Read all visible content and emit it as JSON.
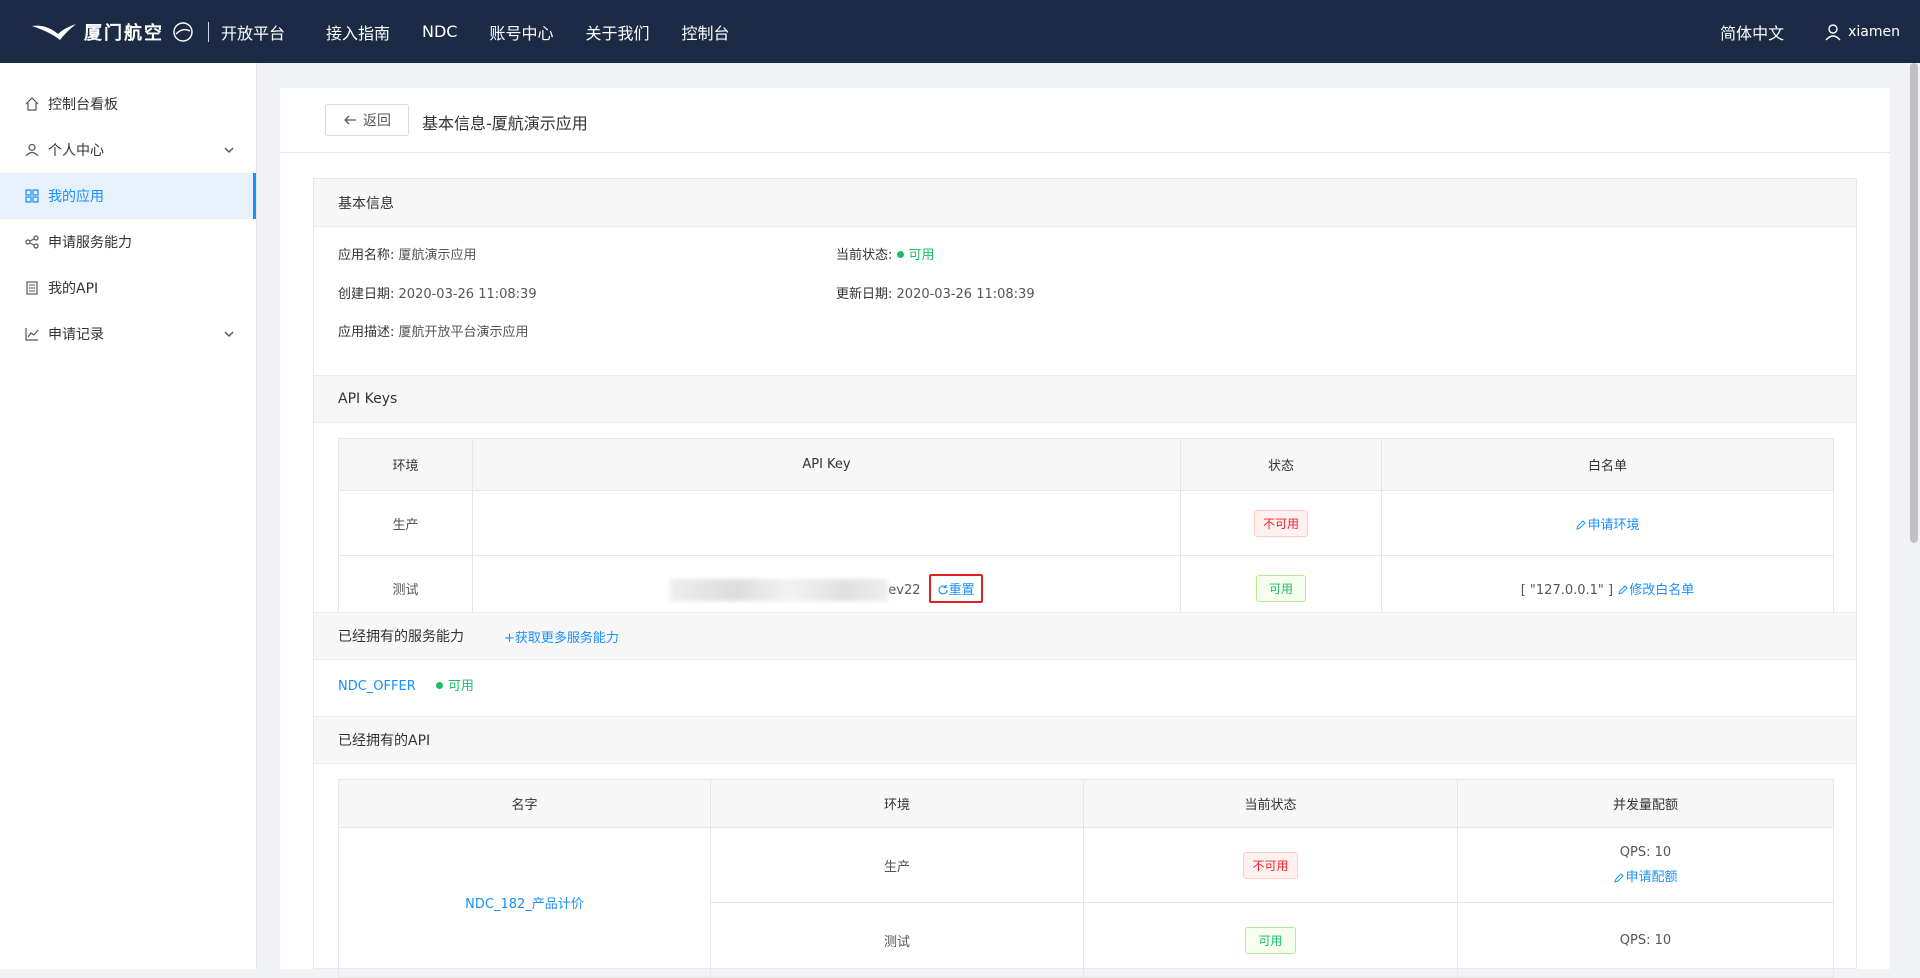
{
  "header": {
    "logo_text": "厦门航空",
    "platform": "开放平台",
    "nav": [
      "接入指南",
      "NDC",
      "账号中心",
      "关于我们",
      "控制台"
    ],
    "language": "简体中文",
    "username": "xiamen"
  },
  "sidebar": {
    "items": [
      {
        "label": "控制台看板",
        "icon": "home-icon"
      },
      {
        "label": "个人中心",
        "icon": "user-icon"
      },
      {
        "label": "我的应用",
        "icon": "grid-icon"
      },
      {
        "label": "申请服务能力",
        "icon": "share-icon"
      },
      {
        "label": "我的API",
        "icon": "doc-icon"
      },
      {
        "label": "申请记录",
        "icon": "chart-icon"
      }
    ]
  },
  "page": {
    "back_label": "返回",
    "title": "基本信息-厦航演示应用"
  },
  "basic_info": {
    "heading": "基本信息",
    "app_name_label": "应用名称:",
    "app_name": "厦航演示应用",
    "status_label": "当前状态:",
    "status": "可用",
    "created_label": "创建日期:",
    "created": "2020-03-26 11:08:39",
    "updated_label": "更新日期:",
    "updated": "2020-03-26 11:08:39",
    "desc_label": "应用描述:",
    "desc": "厦航开放平台演示应用"
  },
  "api_keys": {
    "heading": "API Keys",
    "columns": [
      "环境",
      "API Key",
      "状态",
      "白名单"
    ],
    "rows": [
      {
        "env": "生产",
        "key": "",
        "status": "不可用",
        "action": "申请环境"
      },
      {
        "env": "测试",
        "key_suffix": "ev22",
        "reset": "重置",
        "status": "可用",
        "whitelist": "[ \"127.0.0.1\" ]",
        "action": "修改白名单"
      }
    ]
  },
  "services": {
    "heading": "已经拥有的服务能力",
    "more": "获取更多服务能力",
    "items": [
      {
        "name": "NDC_OFFER",
        "status": "可用"
      }
    ]
  },
  "apis": {
    "heading": "已经拥有的API",
    "columns": [
      "名字",
      "环境",
      "当前状态",
      "并发量配额"
    ],
    "name": "NDC_182_产品计价",
    "rows": [
      {
        "env": "生产",
        "status": "不可用",
        "qps": "QPS: 10",
        "action": "申请配额"
      },
      {
        "env": "测试",
        "status": "可用",
        "qps": "QPS: 10"
      }
    ]
  }
}
